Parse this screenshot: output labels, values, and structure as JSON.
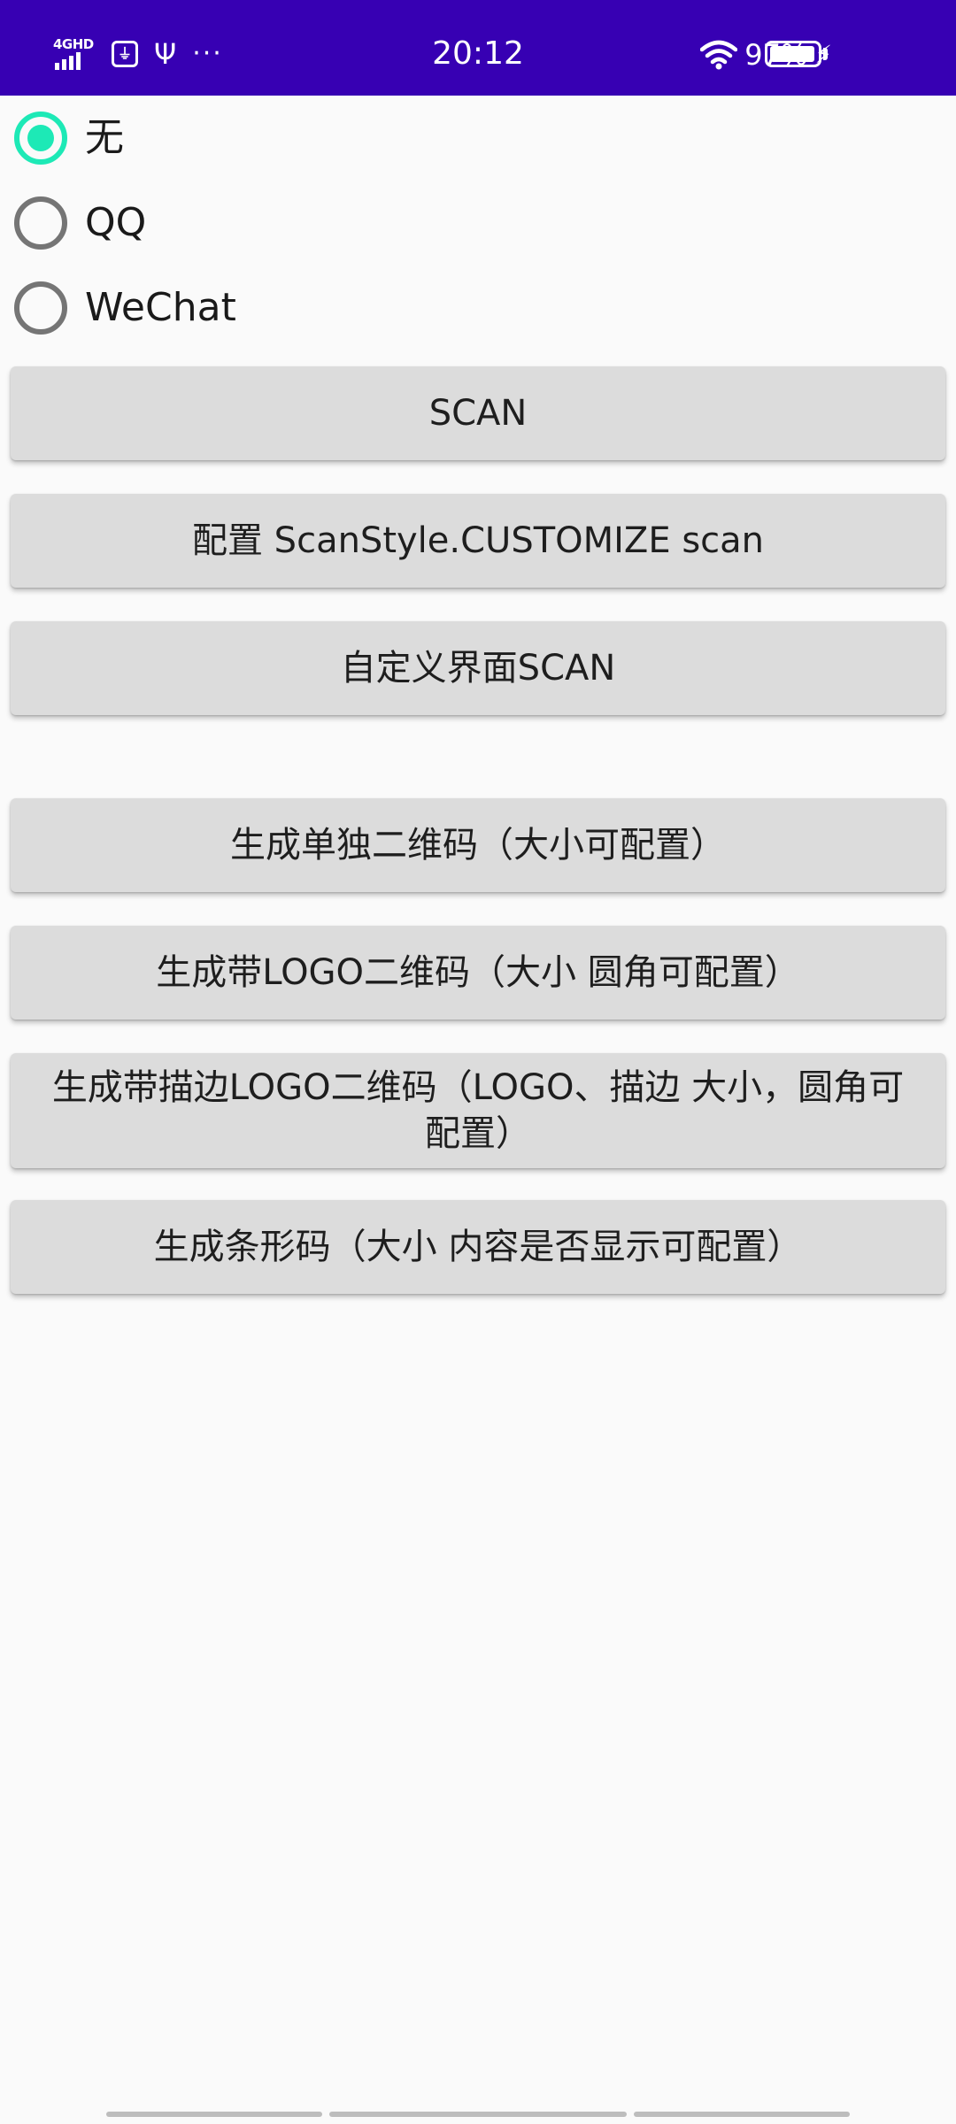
{
  "status_bar": {
    "network_label": "4GHD",
    "time": "20:12",
    "battery_percent": "97%",
    "background_color": "#3700b3",
    "icons": [
      "signal-4g-icon",
      "usb-debug-icon",
      "usb-icon",
      "more-icon",
      "wifi-icon",
      "charging-icon",
      "battery-icon"
    ]
  },
  "radio_group": {
    "options": [
      {
        "label": "无",
        "checked": true
      },
      {
        "label": "QQ",
        "checked": false
      },
      {
        "label": "WeChat",
        "checked": false
      }
    ],
    "accent_color": "#1de9b6"
  },
  "buttons": {
    "scan": "SCAN",
    "customize_scan": "配置 ScanStyle.CUSTOMIZE  scan",
    "custom_ui_scan": "自定义界面SCAN",
    "gen_qr": "生成单独二维码（大小可配置）",
    "gen_logo_qr": "生成带LOGO二维码（大小 圆角可配置）",
    "gen_stroke_logo_qr": "生成带描边LOGO二维码（LOGO、描边 大小，圆角可配置）",
    "gen_barcode": "生成条形码（大小 内容是否显示可配置）"
  }
}
